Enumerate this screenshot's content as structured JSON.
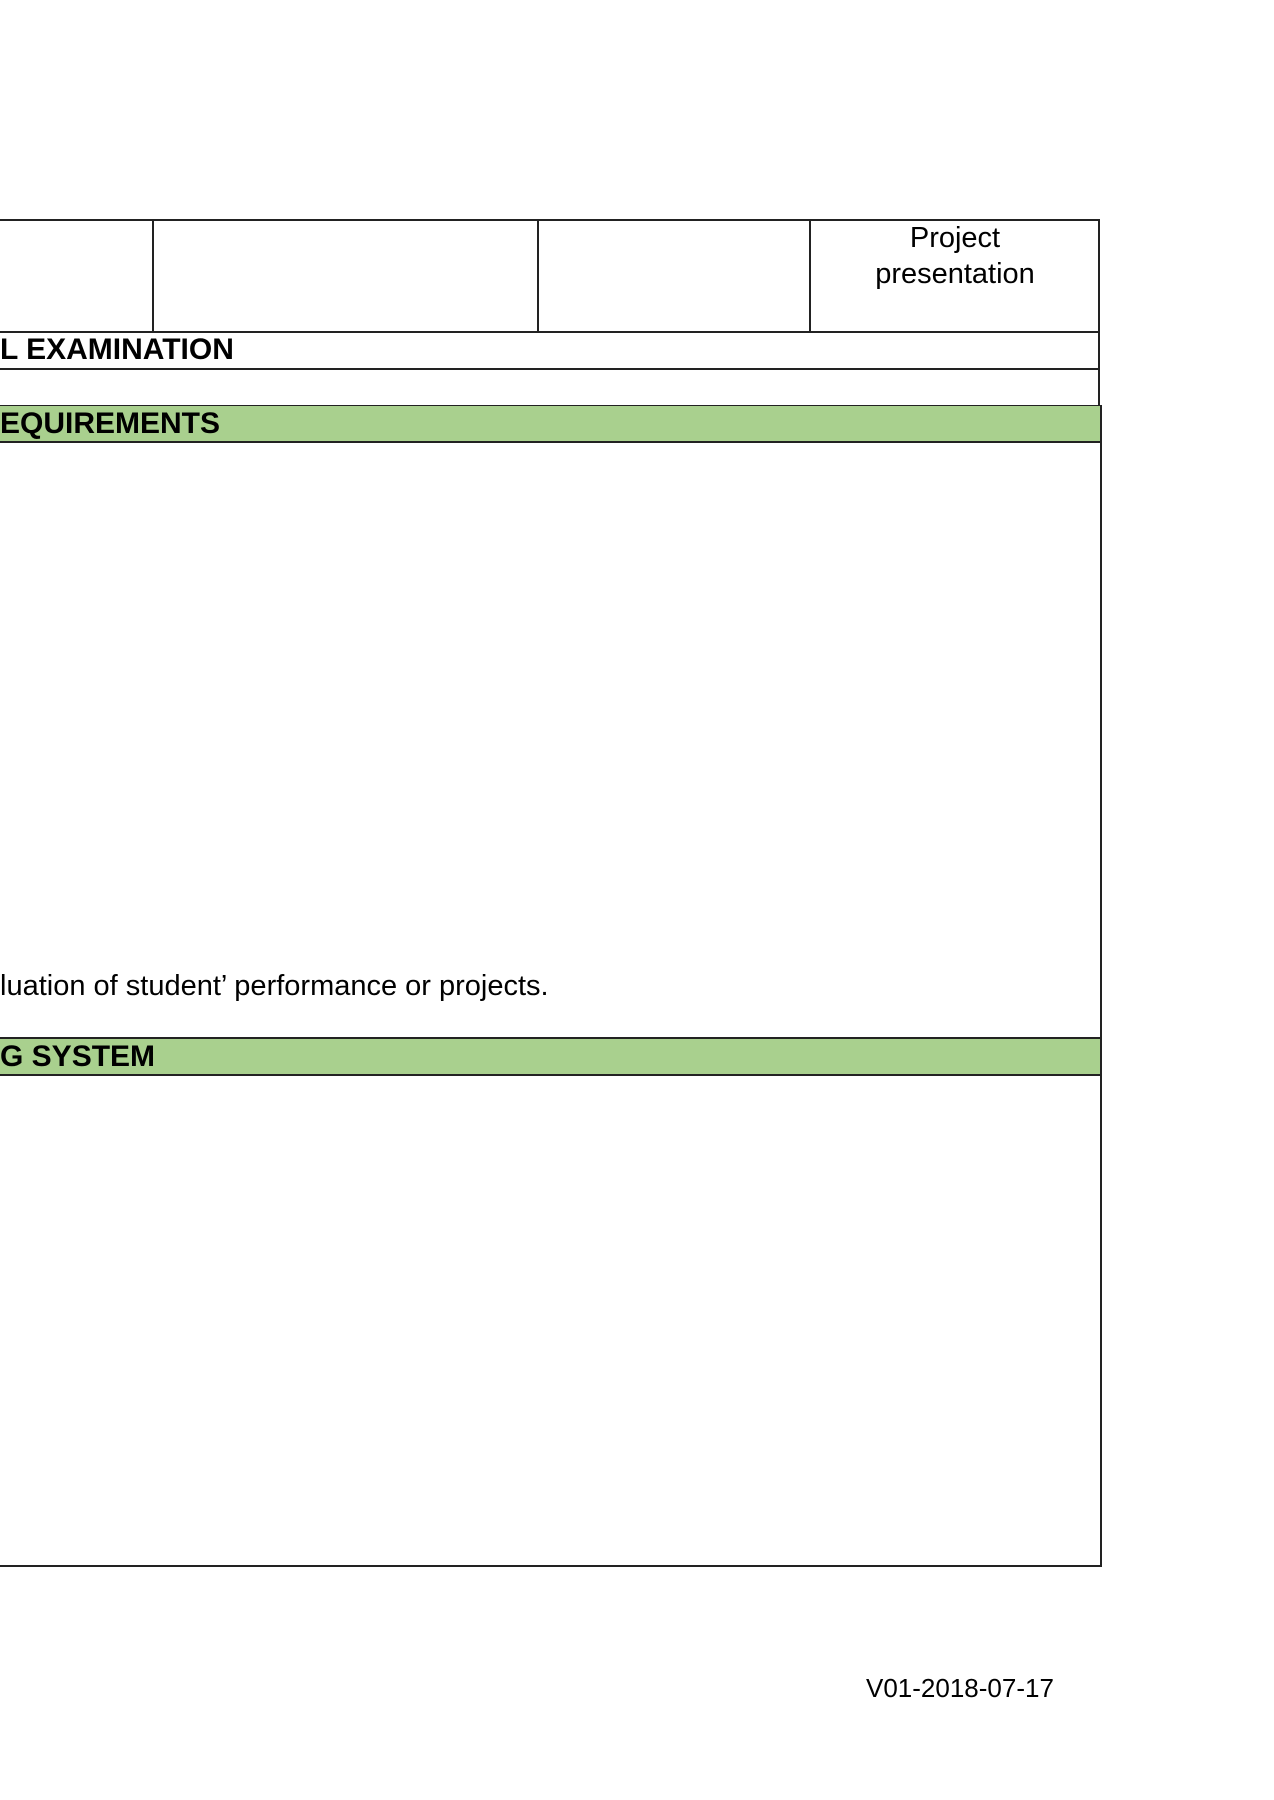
{
  "table_top": {
    "cells": [
      "",
      "",
      "",
      "Project presentation"
    ]
  },
  "sections": {
    "final_examination": "L EXAMINATION",
    "requirements": "EQUIREMENTS",
    "requirements_text": "luation of student’ performance or projects.",
    "grading_system": "G SYSTEM"
  },
  "footer": {
    "version": "V01-2018-07-17"
  },
  "colors": {
    "section_band": "#a9d08e",
    "border": "#222222"
  }
}
